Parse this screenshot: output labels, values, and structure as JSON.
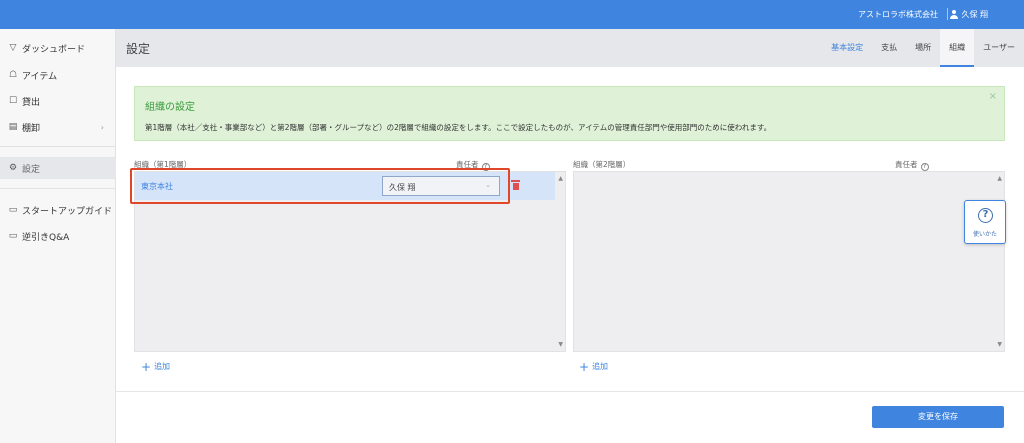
{
  "topbar": {
    "company": "アストロラボ株式会社",
    "user": "久保 翔"
  },
  "sidebar": {
    "items": [
      {
        "label": "ダッシュボード",
        "icon": "dashboard-icon"
      },
      {
        "label": "アイテム",
        "icon": "items-icon"
      },
      {
        "label": "貸出",
        "icon": "lend-icon"
      },
      {
        "label": "棚卸",
        "icon": "inventory-icon"
      },
      {
        "label": "設定",
        "icon": "gear-icon"
      },
      {
        "label": "スタートアップガイド",
        "icon": "book-icon"
      },
      {
        "label": "逆引きQ&A",
        "icon": "book-icon"
      }
    ]
  },
  "header": {
    "title": "設定",
    "tabs": [
      "基本設定",
      "支払",
      "場所",
      "組織",
      "ユーザー"
    ]
  },
  "notice": {
    "title": "組織の設定",
    "body": "第1階層（本社／支社・事業部など）と第2階層（部署・グループなど）の2階層で組織の設定をします。ここで設定したものが、アイテムの管理責任部門や使用部門のために使われます。",
    "close": "×"
  },
  "left_panel": {
    "org_label": "組織（第1階層）",
    "manager_label": "責任者",
    "rows": [
      {
        "name": "東京本社",
        "manager": "久保 翔"
      }
    ],
    "add": "追加"
  },
  "right_panel": {
    "org_label": "組織（第2階層）",
    "manager_label": "責任者",
    "add": "追加"
  },
  "save_button": "変更を保存",
  "help_widget": {
    "label": "使いかた",
    "icon": "?"
  },
  "colors": {
    "brand_blue": "#3f84de",
    "notice_bg": "#dff2d8",
    "notice_title": "#3c9a3c",
    "danger": "#e05050",
    "highlight": "#e0462a"
  }
}
